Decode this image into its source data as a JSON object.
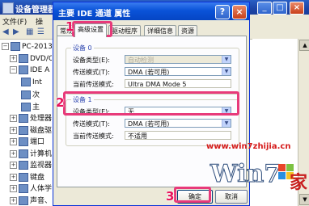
{
  "device_manager": {
    "title": "设备管理器",
    "menu": [
      "文件(F)",
      "操"
    ],
    "tree": [
      {
        "label": "PC-20131",
        "exp": "−",
        "indent": 0
      },
      {
        "label": "DVD/C",
        "exp": "+",
        "indent": 10
      },
      {
        "label": "IDE A",
        "exp": "−",
        "indent": 10
      },
      {
        "label": "Int",
        "exp": "",
        "indent": 24
      },
      {
        "label": "次",
        "exp": "",
        "indent": 24
      },
      {
        "label": "主",
        "exp": "",
        "indent": 24
      },
      {
        "label": "处理器",
        "exp": "+",
        "indent": 10
      },
      {
        "label": "磁盘驱",
        "exp": "+",
        "indent": 10
      },
      {
        "label": "端口",
        "exp": "+",
        "indent": 10
      },
      {
        "label": "计算机",
        "exp": "+",
        "indent": 10
      },
      {
        "label": "监视器",
        "exp": "+",
        "indent": 10
      },
      {
        "label": "键盘",
        "exp": "+",
        "indent": 10
      },
      {
        "label": "人体学",
        "exp": "+",
        "indent": 10
      },
      {
        "label": "声音、",
        "exp": "+",
        "indent": 10
      }
    ]
  },
  "dialog": {
    "title": "主要 IDE 通道 属性",
    "tabs": [
      "常规",
      "高级设置",
      "驱动程序",
      "详细信息",
      "资源"
    ],
    "group0": {
      "label": "设备 0",
      "device_type_label": "设备类型(E):",
      "device_type_value": "自动检测",
      "transfer_mode_label": "传送模式(T):",
      "transfer_mode_value": "DMA (若可用)",
      "current_mode_label": "当前传送模式:",
      "current_mode_value": "Ultra DMA Mode 5"
    },
    "group1": {
      "label": "设备 1",
      "device_type_label": "设备类型(E):",
      "device_type_value": "无",
      "transfer_mode_label": "传送模式(T):",
      "transfer_mode_value": "DMA (若可用)",
      "current_mode_label": "当前传送模式:",
      "current_mode_value": "不适用"
    },
    "ok_label": "确定",
    "cancel_label": "取消"
  },
  "annotations": {
    "step1": "1",
    "step2": "2",
    "step3": "3",
    "color": "#e83a7a"
  },
  "watermark": {
    "url": "www.win7zhijia.cn"
  }
}
